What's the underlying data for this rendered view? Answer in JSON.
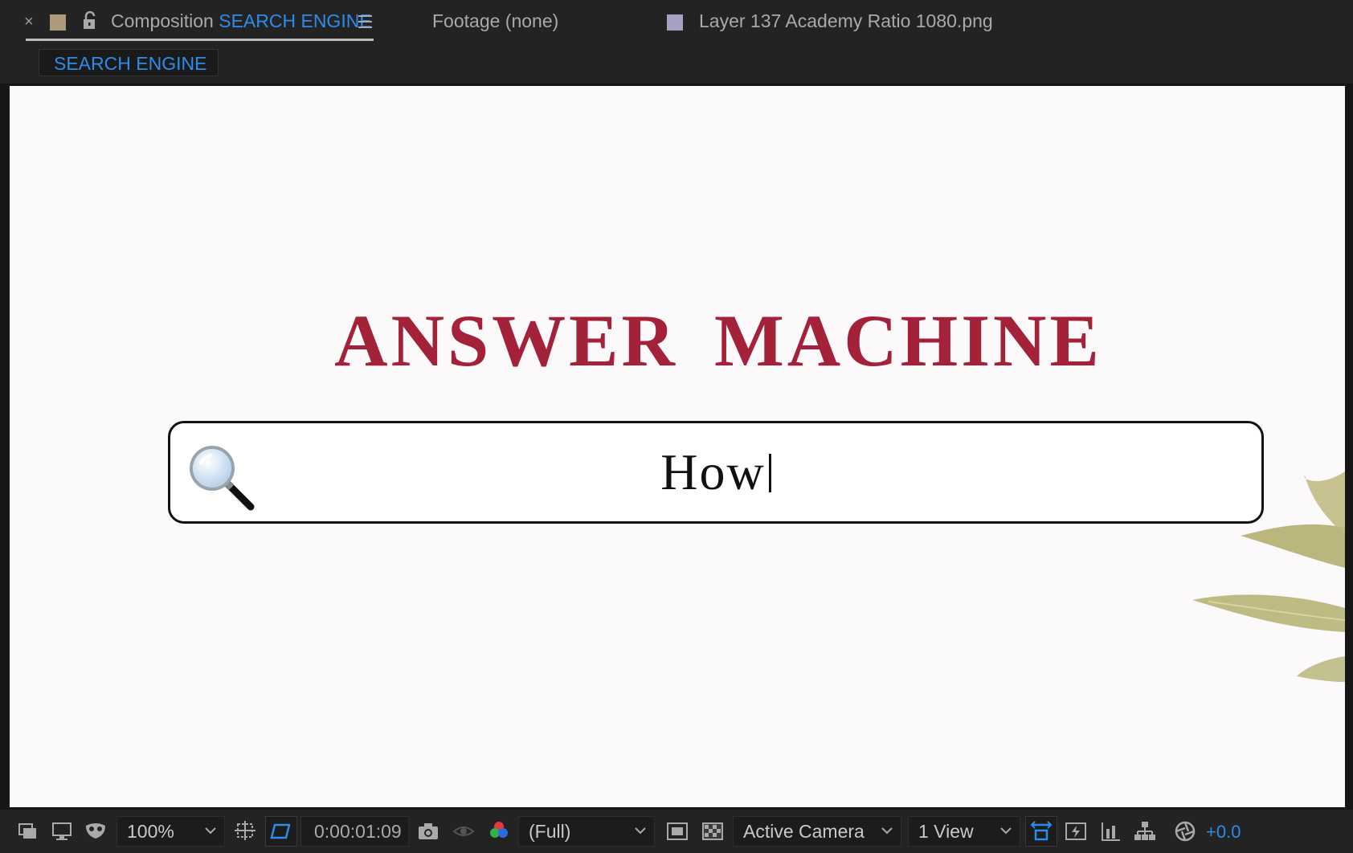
{
  "tabs": {
    "composition_prefix": "Composition",
    "composition_name": "SEARCH ENGINE",
    "footage": "Footage (none)",
    "layer": "Layer 137 Academy Ratio 1080.png"
  },
  "breadcrumb": "SEARCH ENGINE",
  "canvas": {
    "title": "ANSWER MACHINE",
    "search_text": "How"
  },
  "toolbar": {
    "zoom": "100%",
    "timecode": "0:00:01:09",
    "resolution": "(Full)",
    "camera": "Active Camera",
    "views": "1 View",
    "exposure": "+0.0"
  },
  "colors": {
    "accent": "#2d8ceb",
    "title": "#a4213a",
    "comp_swatch": "#ad9a7b",
    "layer_swatch": "#a7a0c4"
  }
}
